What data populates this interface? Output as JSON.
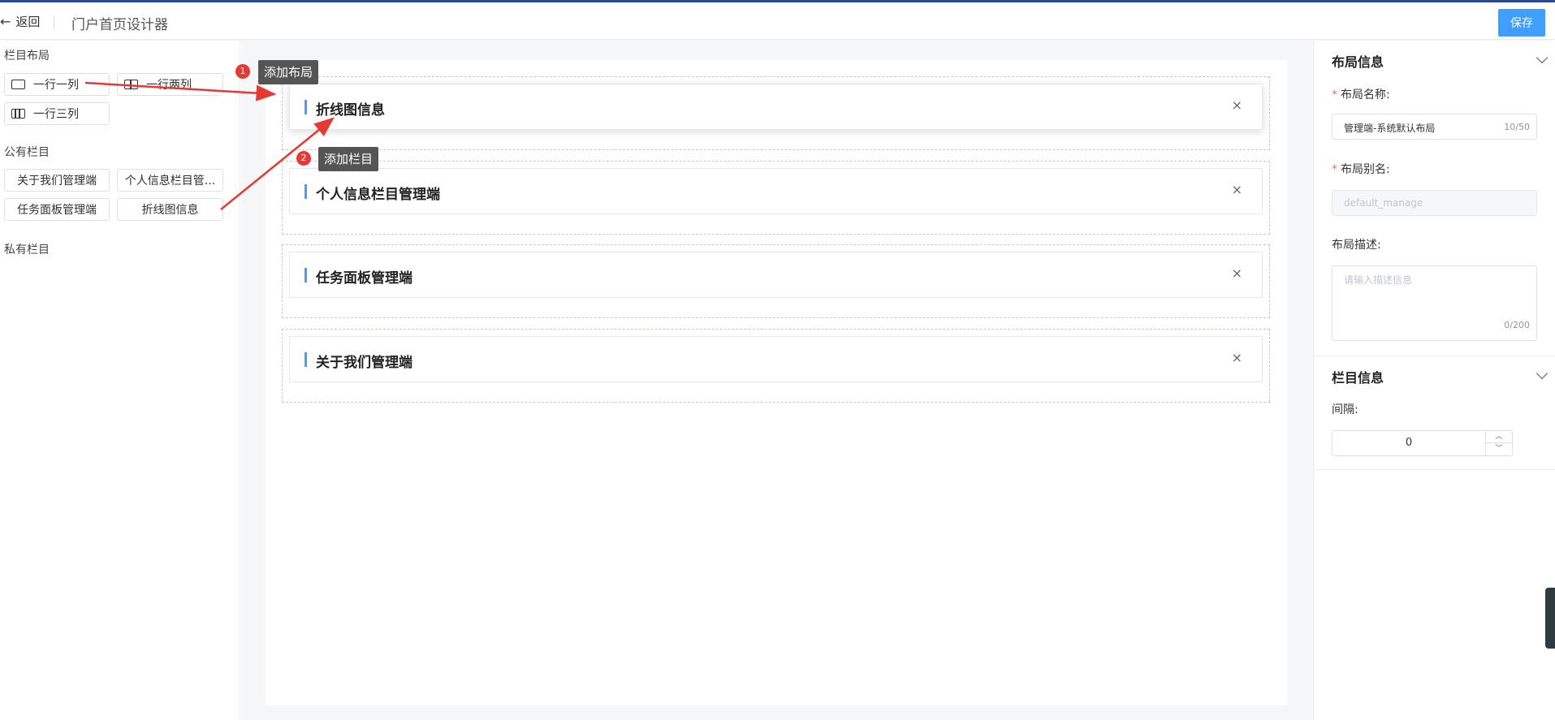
{
  "header": {
    "back_label": "返回",
    "title": "门户首页设计器",
    "save_label": "保存"
  },
  "left": {
    "layout_title": "栏目布局",
    "layouts": [
      "一行一列",
      "一行两列",
      "一行三列"
    ],
    "public_title": "公有栏目",
    "public_items": [
      "关于我们管理端",
      "个人信息栏目管...",
      "任务面板管理端",
      "折线图信息"
    ],
    "private_title": "私有栏目"
  },
  "canvas": {
    "rows": [
      {
        "label": "折线图信息",
        "close": "×"
      },
      {
        "label": "个人信息栏目管理端",
        "close": "×"
      },
      {
        "label": "任务面板管理端",
        "close": "×"
      },
      {
        "label": "关于我们管理端",
        "close": "×"
      }
    ]
  },
  "annotations": [
    {
      "num": "1",
      "text": "添加布局"
    },
    {
      "num": "2",
      "text": "添加栏目"
    }
  ],
  "right": {
    "layout_info_title": "布局信息",
    "name_label": "布局名称:",
    "name_value": "管理端-系统默认布局",
    "name_count": "10/50",
    "alias_label": "布局别名:",
    "alias_value": "default_manage",
    "desc_label": "布局描述:",
    "desc_placeholder": "请输入描述信息",
    "desc_count": "0/200",
    "column_info_title": "栏目信息",
    "gap_label": "间隔:",
    "gap_value": "0"
  },
  "colors": {
    "primary": "#409eff",
    "annotation": "#e53935",
    "required": "#f56c6c"
  }
}
